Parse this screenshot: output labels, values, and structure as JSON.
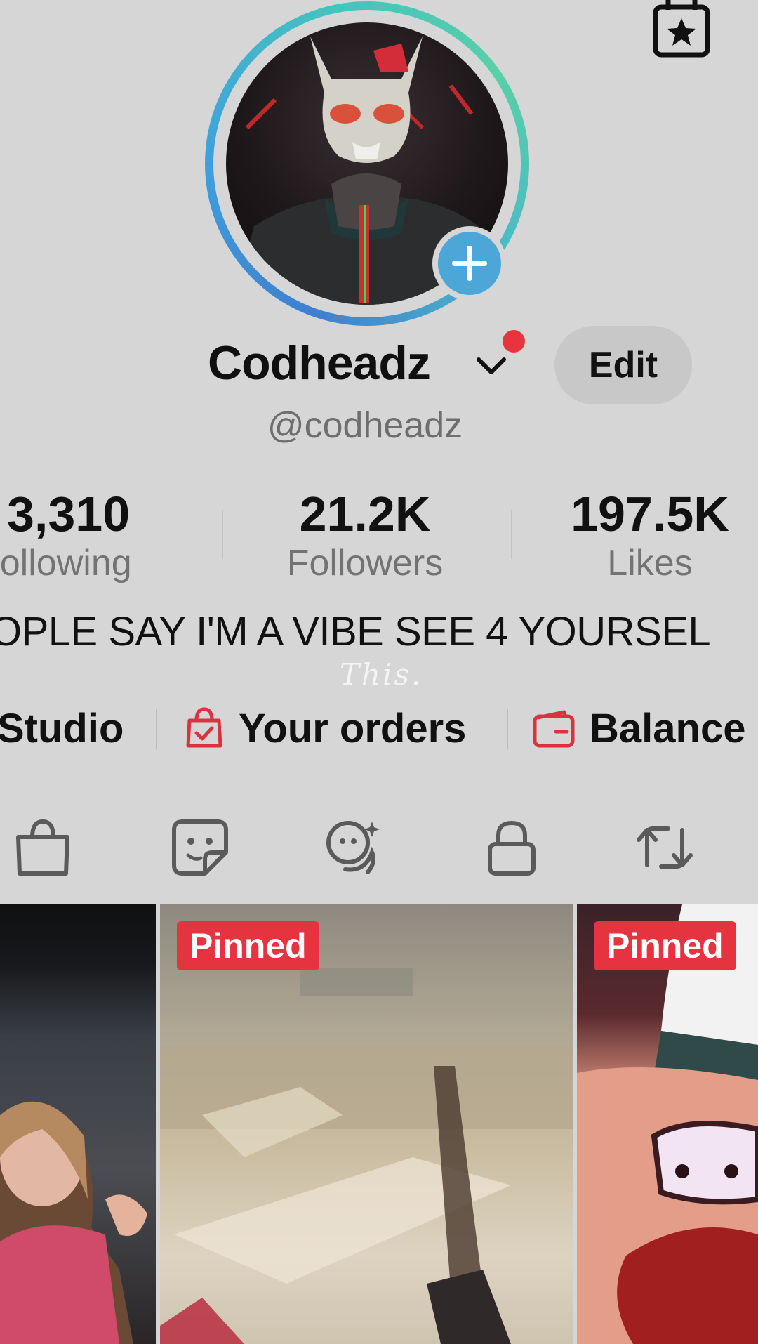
{
  "profile": {
    "display_name": "Codheadz",
    "handle": "@codheadz",
    "edit_label": "Edit",
    "bio": "OPLE SAY I'M A VIBE SEE 4 YOURSEL",
    "watermark": "This."
  },
  "stats": [
    {
      "value": "3,310",
      "label": "Following"
    },
    {
      "value": "21.2K",
      "label": "Followers"
    },
    {
      "value": "197.5K",
      "label": "Likes"
    }
  ],
  "links": {
    "studio": "Studio",
    "orders": "Your orders",
    "balance": "Balance"
  },
  "tabs": [
    {
      "icon": "shopping-bag-icon"
    },
    {
      "icon": "sticker-icon"
    },
    {
      "icon": "ai-face-icon"
    },
    {
      "icon": "lock-icon"
    },
    {
      "icon": "repost-icon"
    }
  ],
  "videos": [
    {
      "pinned_label": ""
    },
    {
      "pinned_label": "Pinned"
    },
    {
      "pinned_label": "Pinned"
    }
  ],
  "colors": {
    "background": "#d6d6d6",
    "accent_red": "#e5343f",
    "plus_blue": "#4da6d8"
  }
}
